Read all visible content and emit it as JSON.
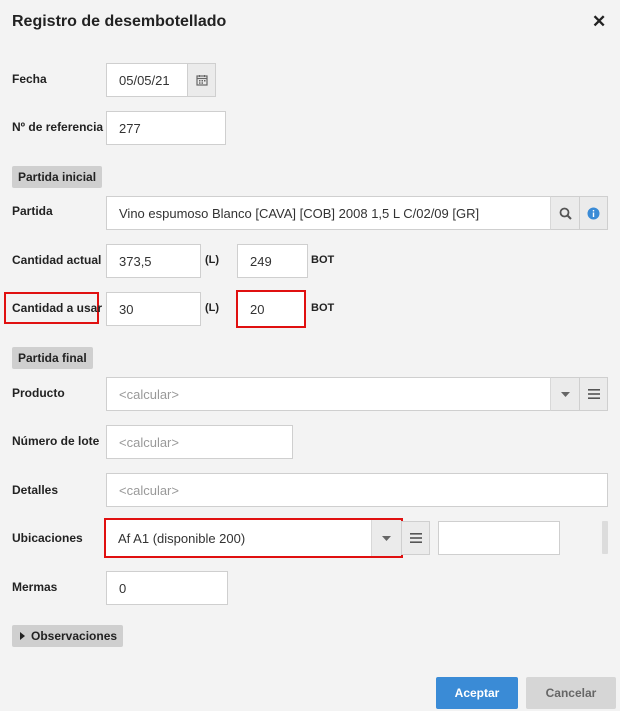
{
  "dialog": {
    "title": "Registro de desembotellado",
    "close_symbol": "✕"
  },
  "fecha": {
    "label": "Fecha",
    "value": "05/05/21"
  },
  "referencia": {
    "label": "Nº de referencia",
    "value": "277"
  },
  "partida_inicial": {
    "section": "Partida inicial",
    "partida_label": "Partida",
    "partida_value": "Vino espumoso Blanco [CAVA] [COB] 2008 1,5 L C/02/09 [GR]",
    "cantidad_actual_label": "Cantidad actual",
    "cantidad_actual_l": "373,5",
    "cantidad_actual_bot": "249",
    "cantidad_usar_label": "Cantidad a usar",
    "cantidad_usar_l": "30",
    "cantidad_usar_bot": "20",
    "unit_l": "(L)",
    "unit_bot": "BOT"
  },
  "partida_final": {
    "section": "Partida final",
    "producto_label": "Producto",
    "producto_placeholder": "<calcular>",
    "lote_label": "Número de lote",
    "lote_placeholder": "<calcular>",
    "detalles_label": "Detalles",
    "detalles_placeholder": "<calcular>",
    "ubicaciones_label": "Ubicaciones",
    "ubicaciones_value": "Af A1 (disponible 200)",
    "ubicaciones_qty": "",
    "mermas_label": "Mermas",
    "mermas_value": "0"
  },
  "observaciones": {
    "label": "Observaciones"
  },
  "footer": {
    "accept_label": "Aceptar",
    "cancel_label": "Cancelar"
  },
  "colors": {
    "primary": "#3a8bd6",
    "highlight": "#e01010",
    "info": "#3a8bd6"
  }
}
